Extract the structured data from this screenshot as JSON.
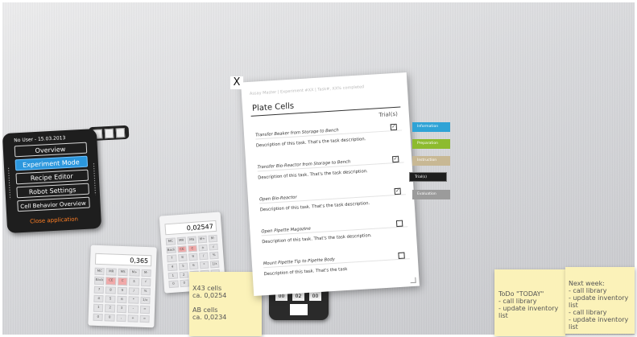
{
  "menu": {
    "user": "No User",
    "date": "15.03.2013",
    "items": [
      {
        "label": "Overview"
      },
      {
        "label": "Experiment Mode"
      },
      {
        "label": "Recipe Editor"
      },
      {
        "label": "Robot Settings"
      },
      {
        "label": "Cell Behavior Overview"
      }
    ],
    "close": "Close application"
  },
  "calculators": [
    {
      "display": "0,365"
    },
    {
      "display": "0,02547"
    }
  ],
  "calc_keys": [
    "MC",
    "MR",
    "MS",
    "M+",
    "M-",
    "Back",
    "CE",
    "C",
    "±",
    "√",
    "7",
    "8",
    "9",
    "/",
    "%",
    "4",
    "5",
    "6",
    "*",
    "1/x",
    "1",
    "2",
    "3",
    "-",
    "=",
    "0",
    "0",
    ",",
    "+",
    "="
  ],
  "notes": [
    {
      "lines": [
        "X43 cells",
        "ca. 0,0254",
        "",
        "AB cells",
        "ca. 0,0234"
      ]
    },
    {
      "lines": [
        "ToDo \"TODAY\"",
        "- call library",
        "- update inventory list"
      ]
    },
    {
      "lines": [
        "Next week:",
        "- call library",
        "- update inventory list",
        "- call library",
        "- update inventory list"
      ]
    }
  ],
  "timer": {
    "h": "00",
    "m": "02",
    "s": "00"
  },
  "sheet": {
    "close": "X",
    "breadcrumbs": "Assay Master  |  Experiment #XX  |  Task#, XX% completed",
    "title": "Plate Cells",
    "trials_header": "Trial(s)",
    "tasks": [
      {
        "name": "Transfer Beaker from Storage to Bench",
        "desc": "Description of this task. That's the task description.",
        "checked": true
      },
      {
        "name": "Transfer Bio-Reactor from Storage to Bench",
        "desc": "Description of this task. That's the task description.",
        "checked": true
      },
      {
        "name": "Open Bio-Reactor",
        "desc": "Description of this task. That's the task description.",
        "checked": true
      },
      {
        "name": "Open Pipette Magazine",
        "desc": "Description of this task. That's the task description.",
        "checked": false
      },
      {
        "name": "Mount Pipette Tip to Pipette Body",
        "desc": "Description of this task. That's the task",
        "checked": false
      }
    ]
  },
  "tabs": [
    {
      "label": "Information",
      "color": "#2fa3d6"
    },
    {
      "label": "Preparation",
      "color": "#8dbb2e"
    },
    {
      "label": "Instruction",
      "color": "#c8b894"
    },
    {
      "label": "Trial(s)",
      "color": "#1e1e1e"
    },
    {
      "label": "Evaluation",
      "color": "#9b9b9b"
    }
  ]
}
